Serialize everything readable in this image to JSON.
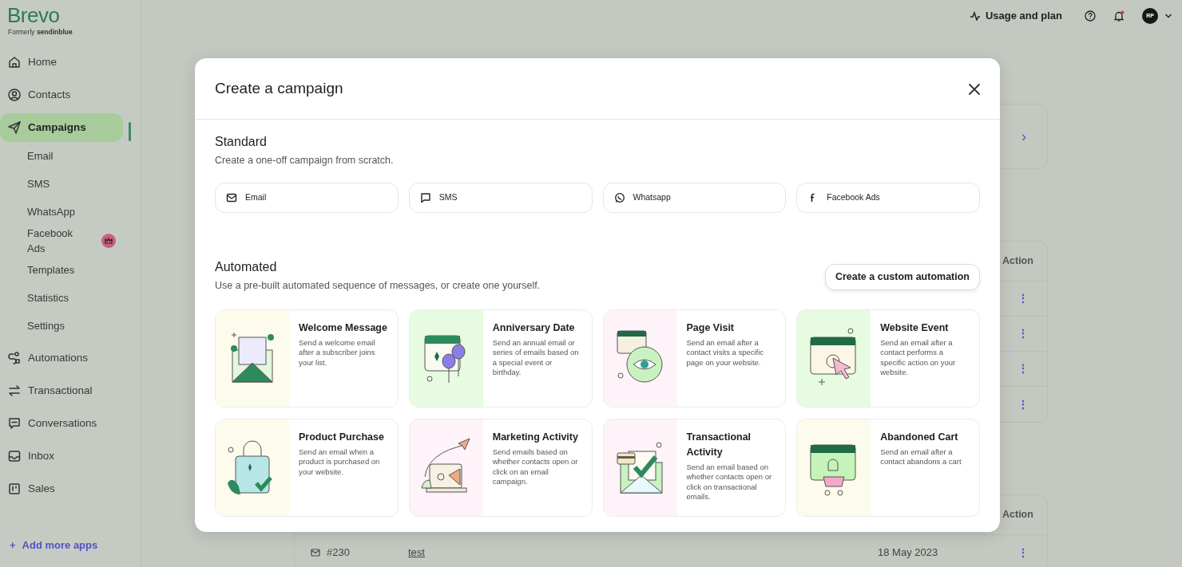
{
  "logo": {
    "name": "Brevo",
    "tagline": "Formerly **sendinblue**"
  },
  "sidebar": {
    "items": [
      {
        "label": "Home",
        "selected": false
      },
      {
        "label": "Contacts",
        "selected": false
      },
      {
        "label": "Campaigns",
        "selected": true,
        "children": [
          {
            "label": "Email",
            "premium": false
          },
          {
            "label": "SMS",
            "premium": false
          },
          {
            "label": "WhatsApp",
            "premium": false
          },
          {
            "label": "Facebook Ads",
            "premium": true
          },
          {
            "label": "Templates",
            "premium": false
          },
          {
            "label": "Statistics",
            "premium": false
          },
          {
            "label": "Settings",
            "premium": false
          }
        ]
      },
      {
        "label": "Automations",
        "selected": false
      },
      {
        "label": "Transactional",
        "selected": false
      },
      {
        "label": "Conversations",
        "selected": false
      },
      {
        "label": "Inbox",
        "selected": false
      },
      {
        "label": "Sales",
        "selected": false
      }
    ],
    "add_apps": {
      "icon": "+",
      "label": "Add more apps"
    }
  },
  "topbar": {
    "usage": "Usage and plan",
    "notification": true,
    "avatar": "RP"
  },
  "background": {
    "panels": [
      {
        "kind": "link",
        "chevron": "›"
      },
      {
        "kind": "table",
        "header": "Action",
        "rows": [
          {
            "action": "⋮"
          },
          {
            "action": "⋮"
          },
          {
            "action": "⋮"
          },
          {
            "action": "⋮"
          }
        ]
      },
      {
        "kind": "table",
        "header": "Action",
        "rows": [
          {
            "id": "#230",
            "name": "test",
            "date": "18 May 2023",
            "action": "⋮"
          }
        ]
      }
    ]
  },
  "modal": {
    "title": "Create a campaign",
    "standard": {
      "title": "Standard",
      "subtitle": "Create a one-off campaign from scratch.",
      "channels": [
        {
          "label": "Email"
        },
        {
          "label": "SMS"
        },
        {
          "label": "Whatsapp"
        },
        {
          "label": "Facebook Ads"
        }
      ]
    },
    "automated": {
      "title": "Automated",
      "subtitle": "Use a pre-built automated sequence of messages, or create one yourself.",
      "button": "Create a custom automation",
      "templates": [
        {
          "title": "Welcome Message",
          "description": "Send a welcome email after a subscriber joins your list.",
          "color": "#fdfbeb"
        },
        {
          "title": "Anniversary Date",
          "description": "Send an annual email or series of emails based on a special event or birthday.",
          "color": "#e6fbe0"
        },
        {
          "title": "Page Visit",
          "description": "Send an email after a contact visits a specific page on your website.",
          "color": "#fdf3f8"
        },
        {
          "title": "Website Event",
          "description": "Send an email after a contact performs a specific action on your website.",
          "color": "#e6fbe0"
        },
        {
          "title": "Product Purchase",
          "description": "Send an email when a product is purchased on your website.",
          "color": "#fdfbeb"
        },
        {
          "title": "Marketing Activity",
          "description": "Send emails based on whether contacts open or click on an email campaign.",
          "color": "#fdf3f8"
        },
        {
          "title": "Transactional Activity",
          "description": "Send an email based on whether contacts open or click on transactional emails.",
          "color": "#fdf3f8"
        },
        {
          "title": "Abandoned Cart",
          "description": "Send an email after a contact abandons a cart",
          "color": "#fdfbeb"
        }
      ]
    }
  }
}
